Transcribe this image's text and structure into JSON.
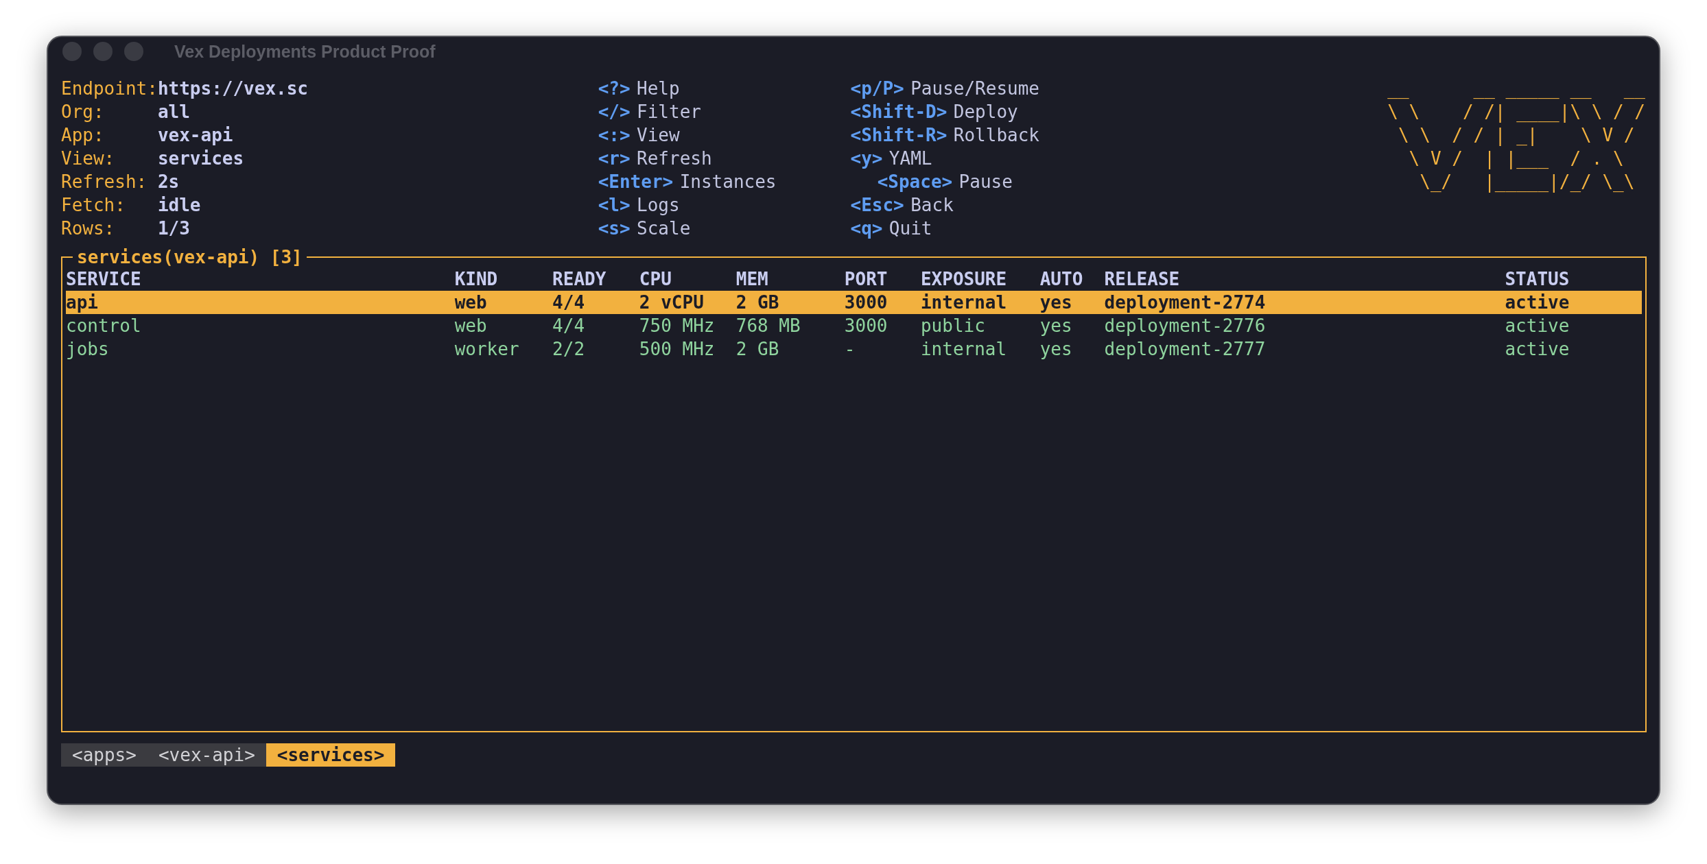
{
  "window": {
    "title": "Vex Deployments Product Proof"
  },
  "info": [
    {
      "label": "Endpoint:",
      "value": "https://vex.sc"
    },
    {
      "label": "Org:",
      "value": "all"
    },
    {
      "label": "App:",
      "value": "vex-api"
    },
    {
      "label": "View:",
      "value": "services"
    },
    {
      "label": "Refresh:",
      "value": "2s"
    },
    {
      "label": "Fetch:",
      "value": "idle"
    },
    {
      "label": "Rows:",
      "value": "1/3"
    }
  ],
  "shortcuts": [
    [
      {
        "key": "<?>",
        "desc": "Help",
        "indent": false
      },
      {
        "key": "</>",
        "desc": "Filter",
        "indent": false
      },
      {
        "key": "<:>",
        "desc": "View",
        "indent": false
      },
      {
        "key": "<r>",
        "desc": "Refresh",
        "indent": false
      },
      {
        "key": "<Enter>",
        "desc": "Instances",
        "indent": false
      },
      {
        "key": "<l>",
        "desc": "Logs",
        "indent": false
      },
      {
        "key": "<s>",
        "desc": "Scale",
        "indent": false
      }
    ],
    [
      {
        "key": "<p/P>",
        "desc": "Pause/Resume",
        "indent": false
      },
      {
        "key": "<Shift-D>",
        "desc": "Deploy",
        "indent": false
      },
      {
        "key": "<Shift-R>",
        "desc": "Rollback",
        "indent": false
      },
      {
        "key": "<y>",
        "desc": "YAML",
        "indent": false
      },
      {
        "key": "<Space>",
        "desc": "Pause",
        "indent": true
      },
      {
        "key": "<Esc>",
        "desc": "Back",
        "indent": false
      },
      {
        "key": "<q>",
        "desc": "Quit",
        "indent": false
      }
    ]
  ],
  "logo": {
    "lines": [
      "__      __ _____ __   __",
      "\\ \\    / /| ____|\\ \\ / /",
      " \\ \\  / / | _|    \\ V / ",
      "  \\ V /  | |___  / . \\ ",
      "   \\_/   |_____|/_/ \\_\\"
    ]
  },
  "table": {
    "title": "services(vex-api) [3]",
    "columns": [
      "SERVICE",
      "KIND",
      "READY",
      "CPU",
      "MEM",
      "PORT",
      "EXPOSURE",
      "AUTO",
      "RELEASE",
      "STATUS"
    ],
    "rows": [
      {
        "selected": true,
        "cells": [
          "api",
          "web",
          "4/4",
          "2 vCPU",
          "2 GB",
          "3000",
          "internal",
          "yes",
          "deployment-2774",
          "active"
        ]
      },
      {
        "selected": false,
        "cells": [
          "control",
          "web",
          "4/4",
          "750 MHz",
          "768 MB",
          "3000",
          "public",
          "yes",
          "deployment-2776",
          "active"
        ]
      },
      {
        "selected": false,
        "cells": [
          "jobs",
          "worker",
          "2/2",
          "500 MHz",
          "2 GB",
          "-",
          "internal",
          "yes",
          "deployment-2777",
          "active"
        ]
      }
    ]
  },
  "breadcrumbs": [
    {
      "label": "<apps>",
      "selected": false
    },
    {
      "label": "<vex-api>",
      "selected": false
    },
    {
      "label": "<services>",
      "selected": true
    }
  ]
}
